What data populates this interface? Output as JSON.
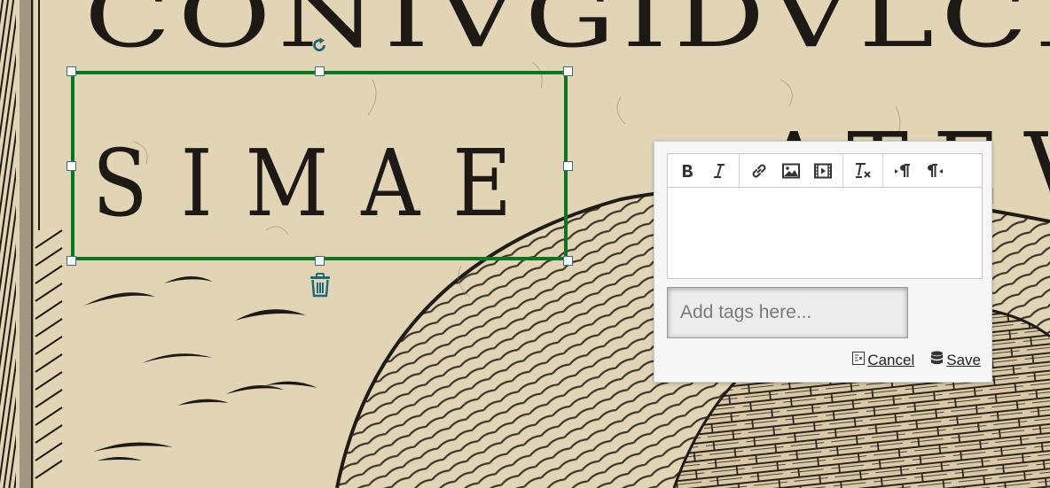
{
  "scan": {
    "top_inscription": "CONIVGIDVLCI",
    "right_inscription": "ATEV",
    "selected_inscription": "SIMAE"
  },
  "selection": {
    "border_color": "#0b7520",
    "rotate_icon": "rotate-icon",
    "delete_icon": "trash-icon"
  },
  "editor": {
    "toolbar": [
      [
        {
          "name": "bold-icon",
          "label": "B"
        },
        {
          "name": "italic-icon",
          "label": "I"
        }
      ],
      [
        {
          "name": "link-icon"
        },
        {
          "name": "image-icon"
        },
        {
          "name": "video-icon"
        }
      ],
      [
        {
          "name": "clear-format-icon"
        }
      ],
      [
        {
          "name": "ltr-icon"
        },
        {
          "name": "rtl-icon"
        }
      ]
    ],
    "tags_placeholder": "Add tags here...",
    "cancel_label": "Cancel",
    "save_label": "Save"
  }
}
